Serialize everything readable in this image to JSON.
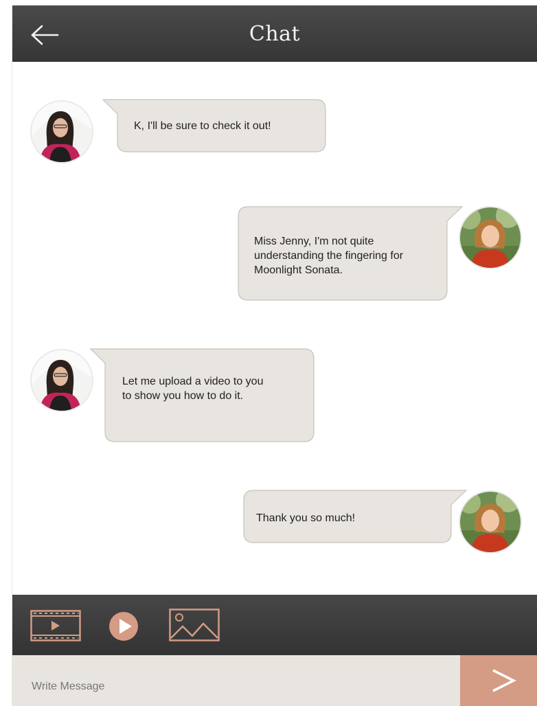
{
  "header": {
    "title": "Chat",
    "back_icon": "arrow-left-icon"
  },
  "colors": {
    "header_bg": "#3d3d3d",
    "bubble_bg": "#e8e4df",
    "accent": "#d49b85",
    "toolbar_bg": "#3b3b3b"
  },
  "messages": [
    {
      "sender": "teacher",
      "side": "left",
      "text_lines": [
        "K, I'll be sure to check it out!"
      ]
    },
    {
      "sender": "student",
      "side": "right",
      "text_lines": [
        "Miss Jenny, I'm not quite",
        "understanding the fingering for",
        "Moonlight Sonata."
      ]
    },
    {
      "sender": "teacher",
      "side": "left",
      "text_lines": [
        "Let me upload a video to you",
        "to show you how to do it."
      ]
    },
    {
      "sender": "student",
      "side": "right",
      "text_lines": [
        "Thank you so much!"
      ]
    }
  ],
  "toolbar": {
    "icons": [
      "video-film-icon",
      "play-icon",
      "image-icon"
    ]
  },
  "composer": {
    "placeholder": "Write Message",
    "send_icon": "send-arrow-icon"
  }
}
